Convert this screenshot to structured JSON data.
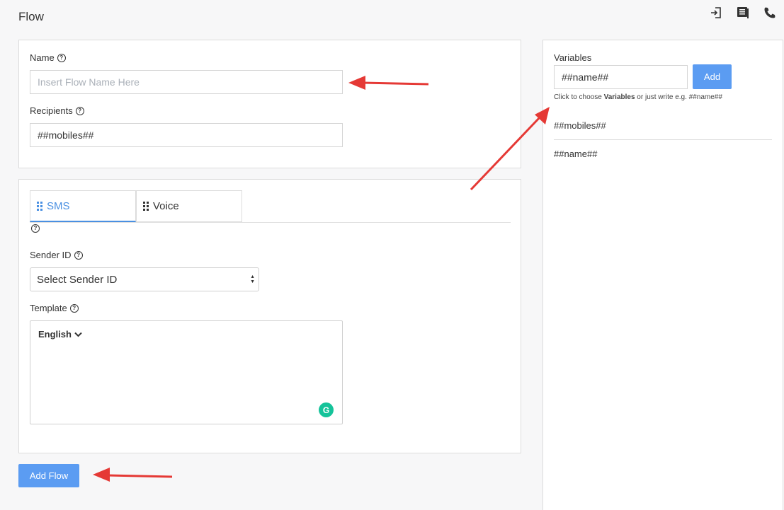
{
  "page": {
    "title": "Flow"
  },
  "top_icons": [
    "sign-out-icon",
    "notes-icon",
    "phone-icon"
  ],
  "name_section": {
    "name_label": "Name",
    "name_placeholder": "Insert Flow Name Here",
    "name_value": "",
    "recipients_label": "Recipients",
    "recipients_value": "##mobiles##"
  },
  "tabs": [
    {
      "label": "SMS",
      "active": true
    },
    {
      "label": "Voice",
      "active": false
    }
  ],
  "sms": {
    "sender_label": "Sender ID",
    "sender_selected": "Select Sender ID",
    "template_label": "Template",
    "language": "English"
  },
  "actions": {
    "add_flow": "Add Flow"
  },
  "variables": {
    "label": "Variables",
    "input_value": "##name##",
    "add_label": "Add",
    "hint_prefix": "Click to choose",
    "hint_bold": "Variables",
    "hint_suffix": "or just write e.g. ##name##",
    "items": [
      "##mobiles##",
      "##name##"
    ]
  },
  "colors": {
    "accent": "#4a90e2",
    "button": "#5b9cf2",
    "annotation": "#e53935",
    "grammarly": "#15c39a"
  }
}
